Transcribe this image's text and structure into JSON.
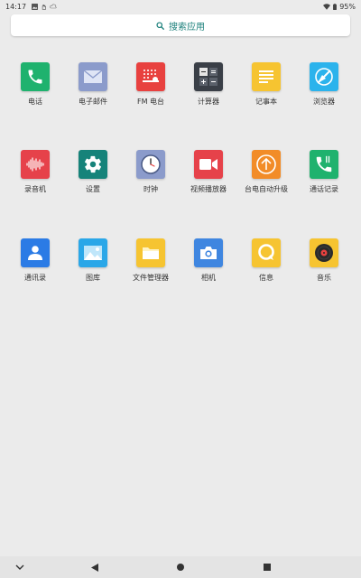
{
  "status_bar": {
    "time": "14:17",
    "battery": "95%"
  },
  "search": {
    "label": "搜索应用"
  },
  "apps": [
    {
      "label": "电话",
      "color": "#1fb26e"
    },
    {
      "label": "电子邮件",
      "color": "#8b9bcb"
    },
    {
      "label": "FM 电台",
      "color": "#e8413f"
    },
    {
      "label": "计算器",
      "color": "#3a3f47"
    },
    {
      "label": "记事本",
      "color": "#f6c431"
    },
    {
      "label": "浏览器",
      "color": "#2bb3ec"
    },
    {
      "label": "录音机",
      "color": "#e6424a"
    },
    {
      "label": "设置",
      "color": "#16837a"
    },
    {
      "label": "时钟",
      "color": "#8b9bcb"
    },
    {
      "label": "视频播放器",
      "color": "#e6424a"
    },
    {
      "label": "台电自动升级",
      "color": "#f28c28"
    },
    {
      "label": "通话记录",
      "color": "#1fb26e"
    },
    {
      "label": "通讯录",
      "color": "#2b7be5"
    },
    {
      "label": "图库",
      "color": "#2aa7e8"
    },
    {
      "label": "文件管理器",
      "color": "#f6c431"
    },
    {
      "label": "相机",
      "color": "#3f86e0"
    },
    {
      "label": "信息",
      "color": "#f6c431"
    },
    {
      "label": "音乐",
      "color": "#f6c431"
    }
  ]
}
